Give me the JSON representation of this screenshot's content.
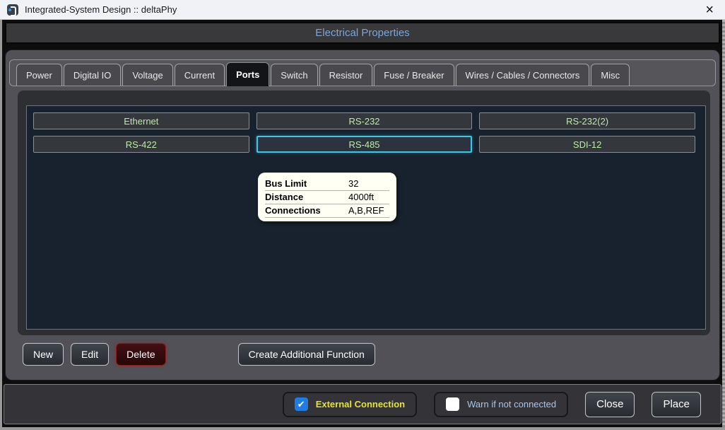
{
  "window": {
    "title": "Integrated-System Design :: deltaPhy",
    "close_glyph": "×"
  },
  "header": {
    "title": "Electrical Properties"
  },
  "tabs": [
    {
      "label": "Power",
      "active": false
    },
    {
      "label": "Digital IO",
      "active": false
    },
    {
      "label": "Voltage",
      "active": false
    },
    {
      "label": "Current",
      "active": false
    },
    {
      "label": "Ports",
      "active": true
    },
    {
      "label": "Switch",
      "active": false
    },
    {
      "label": "Resistor",
      "active": false
    },
    {
      "label": "Fuse / Breaker",
      "active": false
    },
    {
      "label": "Wires / Cables / Connectors",
      "active": false
    },
    {
      "label": "Misc",
      "active": false
    }
  ],
  "ports": {
    "items": [
      {
        "label": "Ethernet",
        "selected": false
      },
      {
        "label": "RS-232",
        "selected": false
      },
      {
        "label": "RS-232(2)",
        "selected": false
      },
      {
        "label": "RS-422",
        "selected": false
      },
      {
        "label": "RS-485",
        "selected": true
      },
      {
        "label": "SDI-12",
        "selected": false
      }
    ]
  },
  "tooltip": {
    "rows": [
      {
        "label": "Bus Limit",
        "value": "32"
      },
      {
        "label": "Distance",
        "value": "4000ft"
      },
      {
        "label": "Connections",
        "value": "A,B,REF"
      }
    ]
  },
  "actions": {
    "new_label": "New",
    "edit_label": "Edit",
    "delete_label": "Delete",
    "create_additional_label": "Create Additional Function"
  },
  "footer": {
    "external_connection": {
      "label": "External Connection",
      "checked": true
    },
    "warn_if_not_connected": {
      "label": "Warn if not connected",
      "checked": false
    },
    "close_label": "Close",
    "place_label": "Place"
  },
  "colors": {
    "accent_cyan": "#3cc8e4",
    "port_text_green": "#bdeca9",
    "header_blue": "#7aa6d8",
    "checkbox_blue": "#1f7ce5",
    "external_label_yellow": "#e6e430",
    "warn_label_blue": "#a6c8ea",
    "delete_border_red": "#8a1f1f"
  }
}
